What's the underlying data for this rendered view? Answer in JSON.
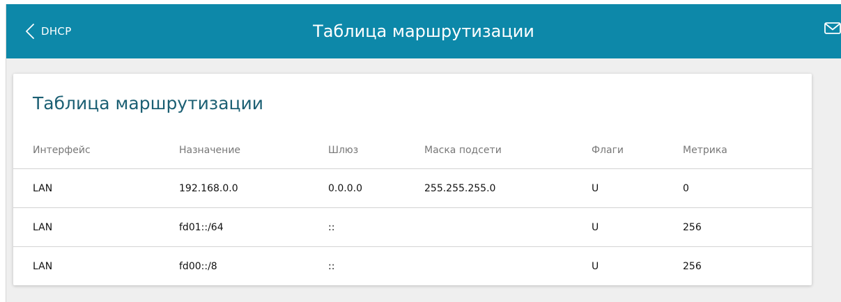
{
  "header": {
    "back_label": "DHCP",
    "title": "Таблица маршрутизации"
  },
  "card": {
    "title": "Таблица маршрутизации"
  },
  "table": {
    "columns": [
      "Интерфейс",
      "Назначение",
      "Шлюз",
      "Маска подсети",
      "Флаги",
      "Метрика"
    ],
    "rows": [
      [
        "LAN",
        "192.168.0.0",
        "0.0.0.0",
        "255.255.255.0",
        "U",
        "0"
      ],
      [
        "LAN",
        "fd01::/64",
        "::",
        "",
        "U",
        "256"
      ],
      [
        "LAN",
        "fd00::/8",
        "::",
        "",
        "U",
        "256"
      ]
    ]
  },
  "colors": {
    "header_bg": "#0d88a9",
    "page_bg": "#efefef",
    "card_title": "#1b5f73"
  },
  "icons": {
    "back": "chevron-left-icon",
    "mail": "envelope-icon"
  }
}
